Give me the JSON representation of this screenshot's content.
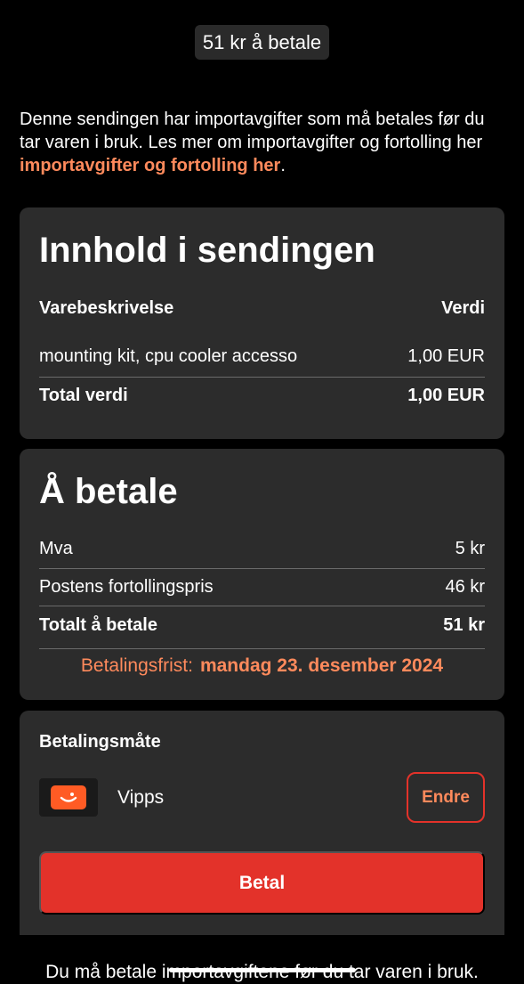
{
  "header": {
    "amount_pill": "51 kr å betale"
  },
  "intro": {
    "text": "Denne sendingen har importavgifter som må betales før du tar varen i bruk. Les mer om importavgifter og fortolling her ",
    "link_text": "importavgifter og fortolling her",
    "suffix": "."
  },
  "contents": {
    "title": "Innhold i sendingen",
    "col_description": "Varebeskrivelse",
    "col_value": "Verdi",
    "items": [
      {
        "description": "mounting kit, cpu cooler accesso",
        "value": "1,00 EUR"
      }
    ],
    "total_label": "Total verdi",
    "total_value": "1,00 EUR"
  },
  "payment": {
    "title": "Å betale",
    "lines": [
      {
        "label": "Mva",
        "value": "5 kr"
      },
      {
        "label": "Postens fortollingspris",
        "value": "46 kr"
      }
    ],
    "total_label": "Totalt å betale",
    "total_value": "51 kr",
    "deadline_label": "Betalingsfrist:",
    "deadline_date": "mandag 23. desember 2024"
  },
  "method": {
    "label": "Betalingsmåte",
    "provider_icon": "vipps-logo-icon",
    "provider_name": "Vipps",
    "change_label": "Endre",
    "pay_label": "Betal"
  },
  "footer": {
    "note": "Du må betale importavgiftene før du tar varen i bruk."
  },
  "colors": {
    "accent": "#ff8a5c",
    "primary_button": "#e3322a",
    "card_bg": "#2c2c2c",
    "vipps_orange": "#ff5b24"
  }
}
